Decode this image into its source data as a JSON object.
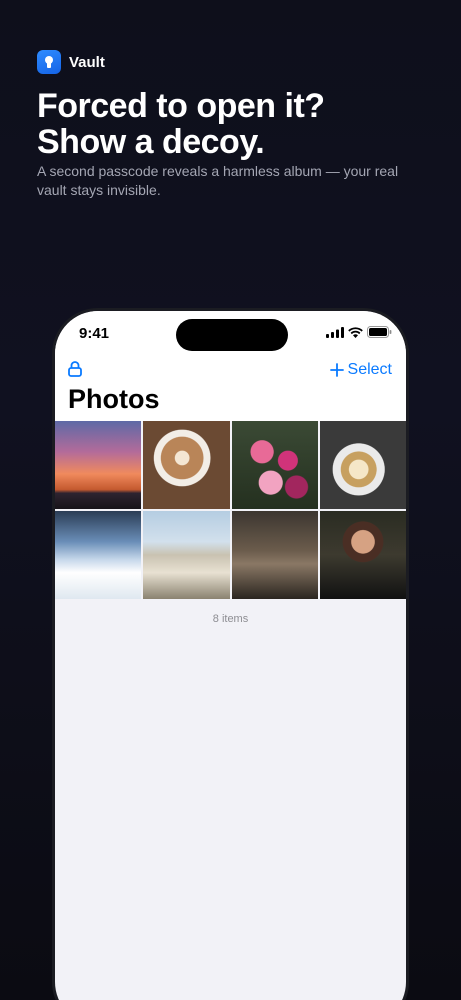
{
  "brand": {
    "name": "Vault",
    "logo_icon": "keyhole-icon",
    "accent": "#1f78ff"
  },
  "headline": {
    "line1": "Forced to open it?",
    "line2": "Show a decoy."
  },
  "subtitle": "A second passcode reveals a harmless album — your real vault stays invisible.",
  "phone": {
    "status": {
      "time": "9:41",
      "icons": [
        "signal-icon",
        "wifi-icon",
        "battery-icon"
      ]
    },
    "nav": {
      "lock_icon": "lock-icon",
      "select_label": "Select",
      "add_icon": "plus-icon"
    },
    "album_title": "Photos",
    "photos": [
      {
        "name": "photo-sunset"
      },
      {
        "name": "photo-latte"
      },
      {
        "name": "photo-flowers"
      },
      {
        "name": "photo-salad"
      },
      {
        "name": "photo-airplane-window"
      },
      {
        "name": "photo-hillside-town"
      },
      {
        "name": "photo-desk"
      },
      {
        "name": "photo-portrait"
      }
    ],
    "item_count": "8 items",
    "accent": "#0a7aff"
  }
}
